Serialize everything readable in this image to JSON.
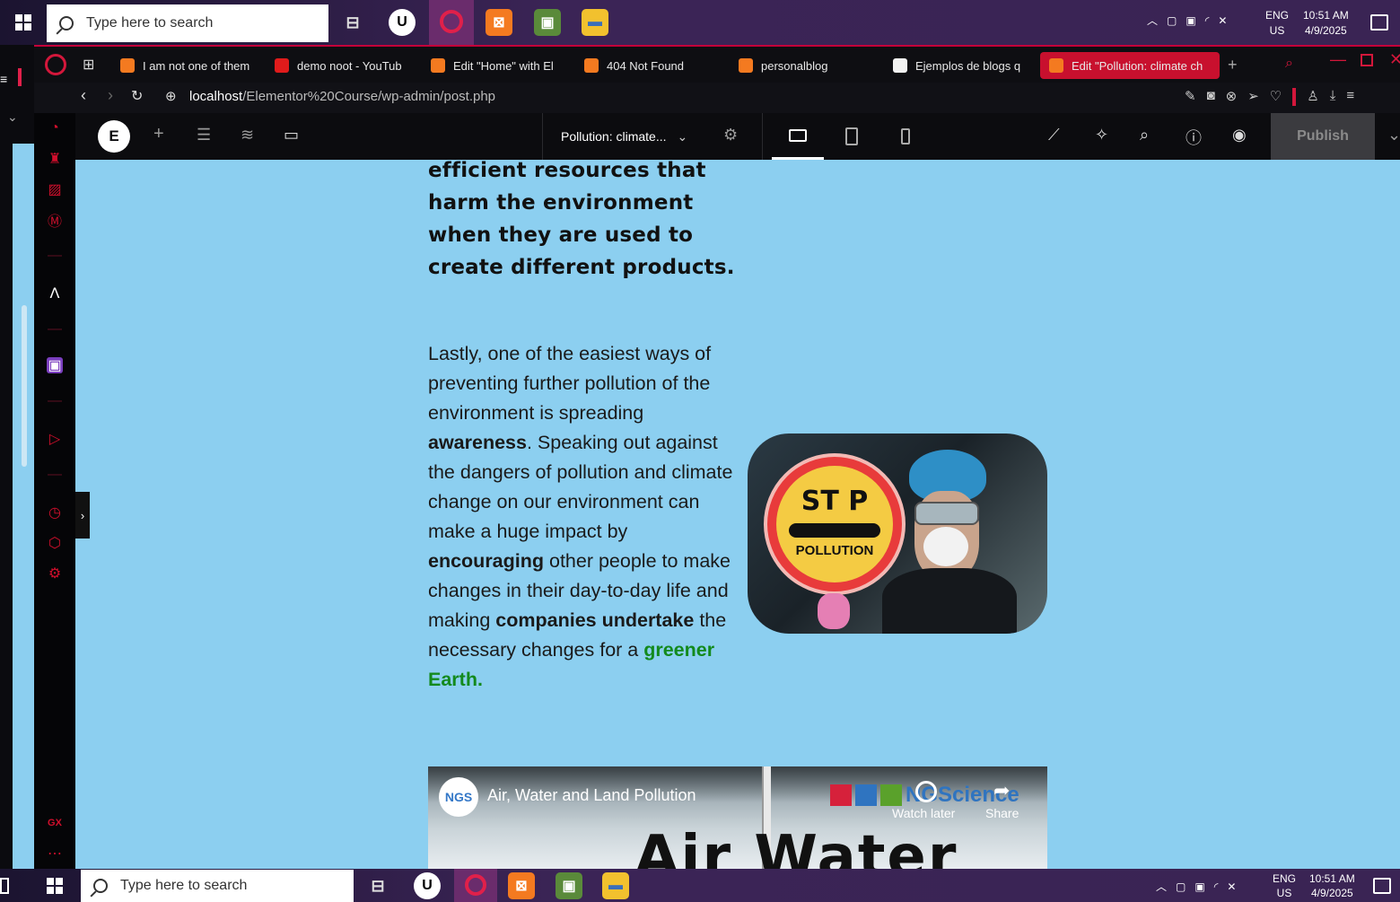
{
  "taskbar": {
    "search_placeholder": "Type here to search",
    "clock_time": "10:51 AM",
    "clock_date": "4/9/2025",
    "lang_top": "ENG",
    "lang_bottom": "US"
  },
  "browser": {
    "tabs": [
      {
        "label": "I am not one of them",
        "icon": "xampp-icon"
      },
      {
        "label": "demo noot - YouTub",
        "icon": "youtube-icon"
      },
      {
        "label": "Edit \"Home\" with El",
        "icon": "xampp-icon"
      },
      {
        "label": "404 Not Found",
        "icon": "xampp-icon"
      },
      {
        "label": "personalblog",
        "icon": "xampp-icon"
      },
      {
        "label": "Ejemplos de blogs q",
        "icon": "wix-icon"
      },
      {
        "label": "Edit \"Pollution: climate ch",
        "icon": "xampp-icon"
      }
    ],
    "url_host": "localhost",
    "url_path": "/Elementor%20Course/wp-admin/post.php"
  },
  "elementor": {
    "logo": "E",
    "page_title": "Pollution: climate...",
    "publish_label": "Publish"
  },
  "content": {
    "heading_lines": [
      "efficient resources that",
      "harm the environment",
      "when they are used to",
      "create different products."
    ],
    "para": {
      "p1": "Lastly, one of the easiest ways of preventing further pollution of the environment is spreading ",
      "b1": "awareness",
      "p2": ". Speaking out against the dangers of pollution and climate change on our environment can make a huge impact by ",
      "b2": "encouraging",
      "p3": " other people to make changes in their day-to-day life and making ",
      "b3": "companies undertake",
      "p4": " the necessary changes for a ",
      "green": "greener Earth."
    },
    "photo": {
      "sign_line1": "ST P",
      "sign_line2": "POLLUTION"
    },
    "video": {
      "channel_logo": "NGS",
      "title": "Air, Water and Land Pollution",
      "watch_later": "Watch later",
      "share": "Share",
      "brand": "NGScience",
      "big_text": "Air Water"
    }
  },
  "colors": {
    "page_bg": "#8ccff0",
    "opera_red": "#c8102e",
    "green_link": "#138a1d"
  }
}
